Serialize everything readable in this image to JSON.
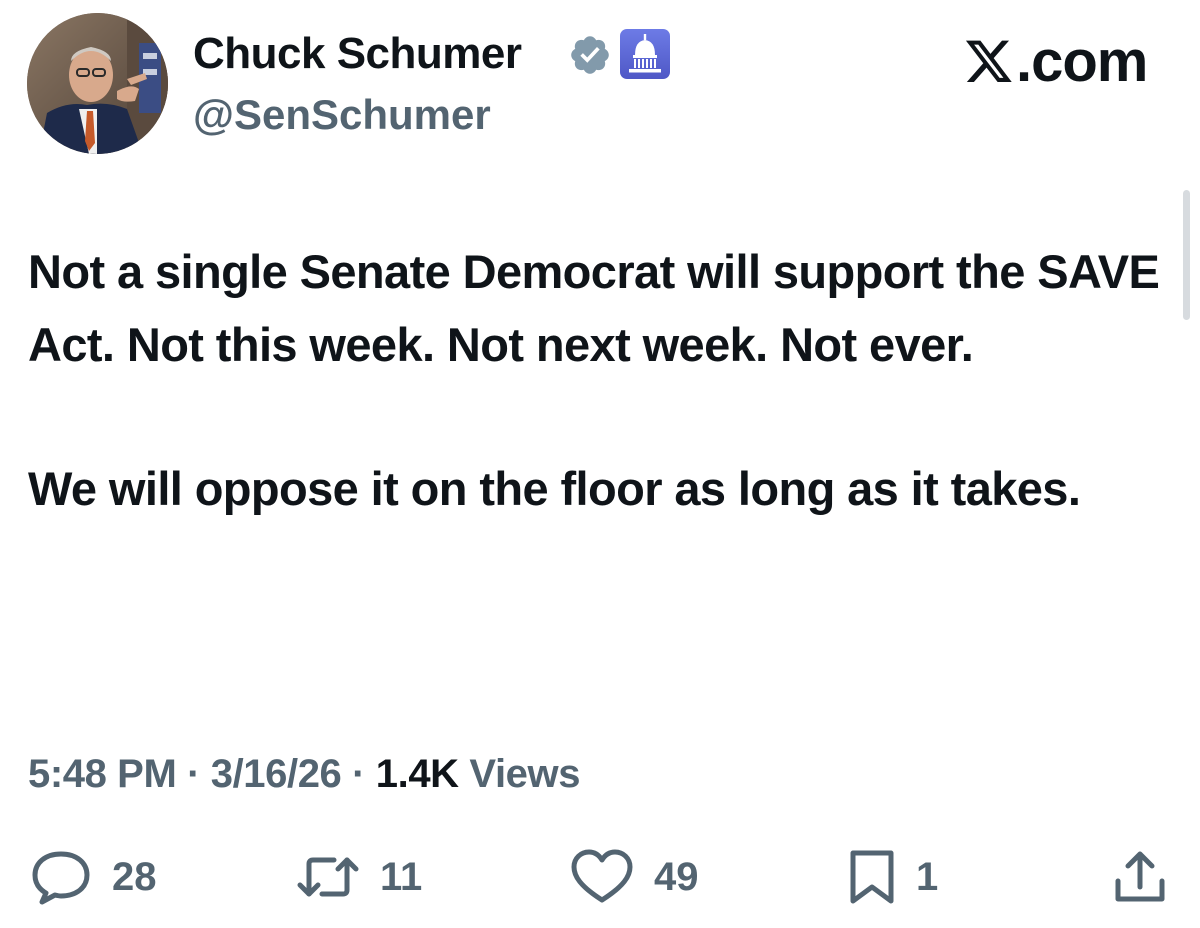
{
  "author": {
    "display_name": "Chuck Schumer",
    "handle": "@SenSchumer",
    "avatar_icon": "avatar-photo",
    "verified_icon": "verified-badge-icon",
    "affiliation_icon": "capitol-dome-icon"
  },
  "brand": {
    "logo_icon": "x-logo-icon",
    "domain": ".com"
  },
  "tweet": {
    "paragraph_1": "Not a single Senate Democrat will support the SAVE Act. Not this week. Not next week. Not ever.",
    "paragraph_2": "We will oppose it on the floor as long as it takes."
  },
  "meta": {
    "time": "5:48 PM",
    "separator": "·",
    "date": "3/16/26",
    "views_count": "1.4K",
    "views_label": "Views"
  },
  "actions": {
    "replies": "28",
    "reposts": "11",
    "likes": "49",
    "bookmarks": "1"
  },
  "colors": {
    "text_primary": "#0f1419",
    "text_secondary": "#536471",
    "verified_badge": "#829aab",
    "affiliation_badge": "#5b66d6"
  }
}
